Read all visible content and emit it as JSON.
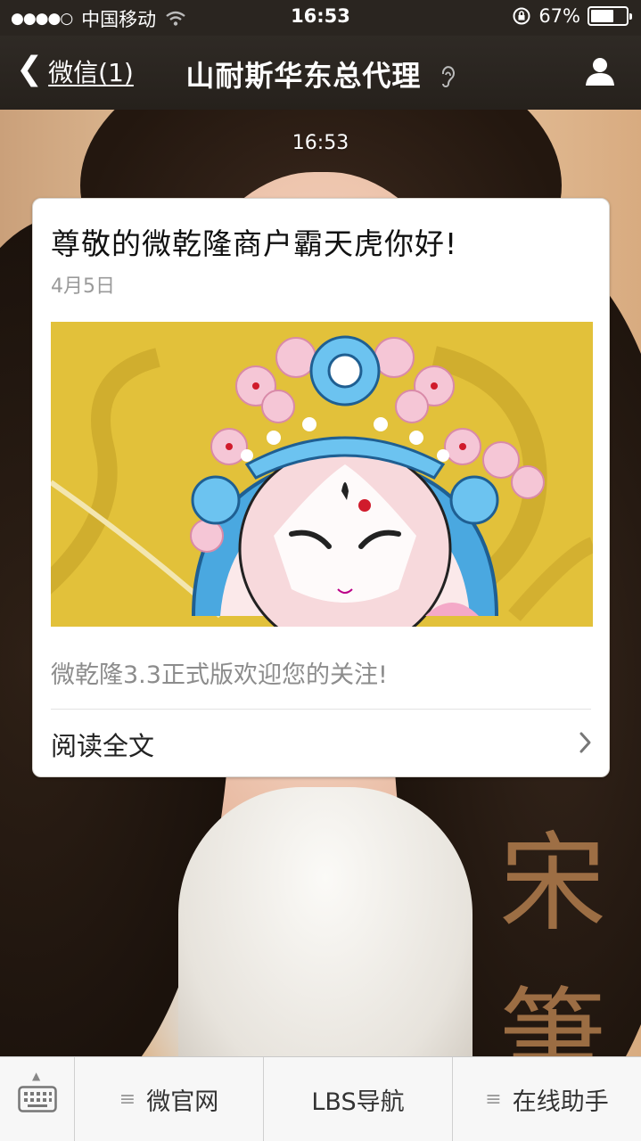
{
  "status_bar": {
    "signal": "●●●●○",
    "carrier": "中国移动",
    "time": "16:53",
    "battery_text": "67%",
    "battery_level": 0.67
  },
  "nav": {
    "back_label": "微信(1)",
    "title": "山耐斯华东总代理"
  },
  "chat": {
    "timestamp": "16:53"
  },
  "article": {
    "title": "尊敬的微乾隆商户霸天虎你好!",
    "date": "4月5日",
    "description": "微乾隆3.3正式版欢迎您的关注!",
    "read_more": "阅读全文"
  },
  "background": {
    "calligraphy": "宋筆"
  },
  "menu": {
    "items": [
      "微官网",
      "LBS导航",
      "在线助手"
    ]
  },
  "colors": {
    "bar_dark": "#2a2520",
    "card_bg": "#ffffff",
    "image_yellow": "#e2c13a",
    "opera_blue": "#4aa8e0"
  }
}
